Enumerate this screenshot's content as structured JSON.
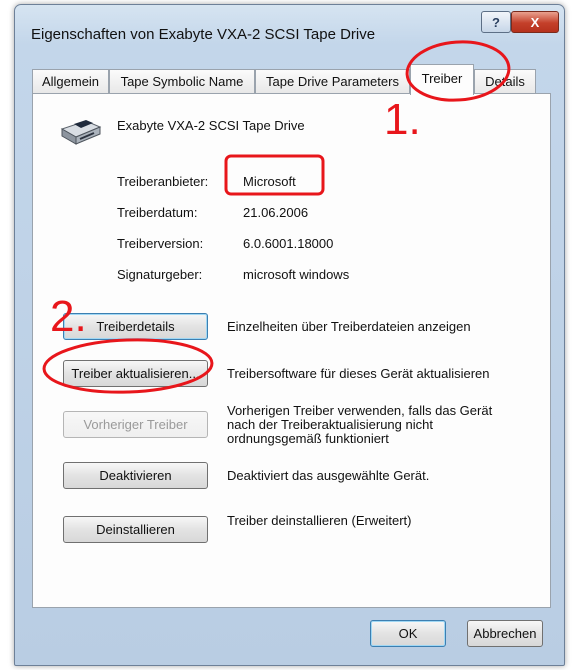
{
  "window": {
    "title": "Eigenschaften von Exabyte VXA-2 SCSI Tape Drive",
    "help_glyph": "?",
    "close_glyph": "X"
  },
  "tabs": [
    {
      "label": "Allgemein",
      "active": false
    },
    {
      "label": "Tape Symbolic Name",
      "active": false
    },
    {
      "label": "Tape Drive Parameters",
      "active": false
    },
    {
      "label": "Treiber",
      "active": true
    },
    {
      "label": "Details",
      "active": false
    }
  ],
  "device": {
    "icon": "tape-drive-icon",
    "name": "Exabyte VXA-2 SCSI Tape Drive"
  },
  "properties": [
    {
      "label": "Treiberanbieter:",
      "value": "Microsoft"
    },
    {
      "label": "Treiberdatum:",
      "value": "21.06.2006"
    },
    {
      "label": "Treiberversion:",
      "value": "6.0.6001.18000"
    },
    {
      "label": "Signaturgeber:",
      "value": "microsoft windows"
    }
  ],
  "actions": [
    {
      "label": "Treiberdetails",
      "description": [
        "Einzelheiten über Treiberdateien anzeigen"
      ],
      "enabled": true
    },
    {
      "label": "Treiber aktualisieren...",
      "description": [
        "Treibersoftware für dieses Gerät aktualisieren"
      ],
      "enabled": true
    },
    {
      "label": "Vorheriger Treiber",
      "description": [
        "Vorherigen Treiber verwenden, falls das Gerät",
        "nach der Treiberaktualisierung nicht",
        "ordnungsgemäß funktioniert"
      ],
      "enabled": false
    },
    {
      "label": "Deaktivieren",
      "description": [
        "Deaktiviert das ausgewählte Gerät."
      ],
      "enabled": true
    },
    {
      "label": "Deinstallieren",
      "description": [
        "Treiber deinstallieren (Erweitert)"
      ],
      "enabled": true
    }
  ],
  "footer": {
    "ok_label": "OK",
    "cancel_label": "Abbrechen"
  },
  "annotations": {
    "step_1": "1.",
    "step_2": "2.",
    "color": "#e8161b"
  }
}
